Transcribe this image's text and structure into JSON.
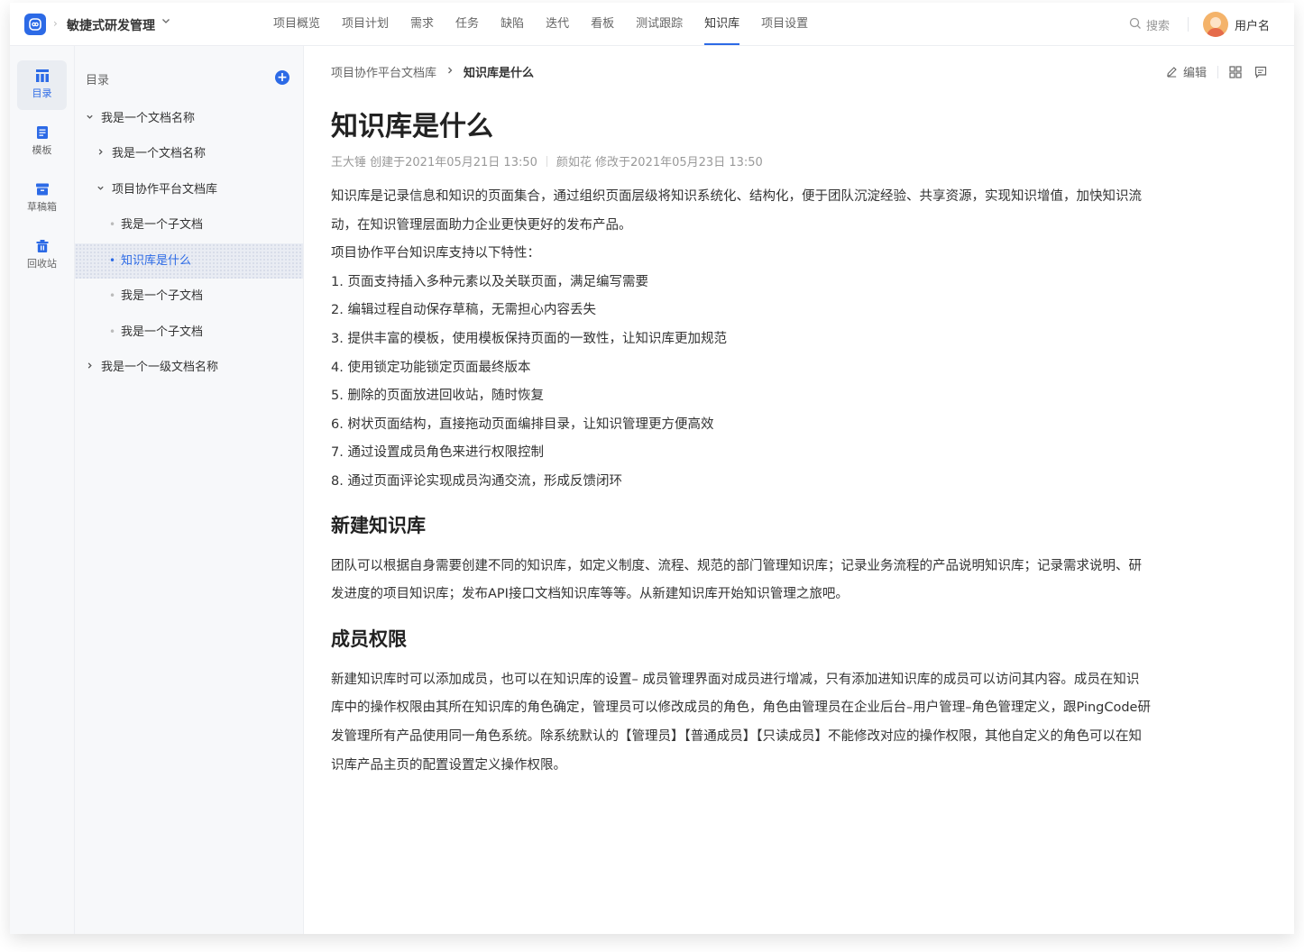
{
  "app": {
    "project_name": "敏捷式研发管理",
    "nav": [
      "项目概览",
      "项目计划",
      "需求",
      "任务",
      "缺陷",
      "迭代",
      "看板",
      "测试跟踪",
      "知识库",
      "项目设置"
    ],
    "active_nav": "知识库",
    "search_label": "搜索",
    "username": "用户名"
  },
  "rail": {
    "items": [
      {
        "label": "目录",
        "icon": "catalog-icon",
        "active": true
      },
      {
        "label": "模板",
        "icon": "template-icon",
        "active": false
      },
      {
        "label": "草稿箱",
        "icon": "draft-box-icon",
        "active": false
      },
      {
        "label": "回收站",
        "icon": "recycle-bin-icon",
        "active": false
      }
    ]
  },
  "toc": {
    "title": "目录",
    "add_label": "+",
    "items": [
      {
        "label": "我是一个文档名称",
        "level": 0,
        "type": "expanded"
      },
      {
        "label": "我是一个文档名称",
        "level": 1,
        "type": "collapsed"
      },
      {
        "label": "项目协作平台文档库",
        "level": 1,
        "type": "expanded"
      },
      {
        "label": "我是一个子文档",
        "level": 2,
        "type": "leaf"
      },
      {
        "label": "知识库是什么",
        "level": 2,
        "type": "leaf",
        "active": true
      },
      {
        "label": "我是一个子文档",
        "level": 2,
        "type": "leaf"
      },
      {
        "label": "我是一个子文档",
        "level": 2,
        "type": "leaf"
      },
      {
        "label": "我是一个一级文档名称",
        "level": 0,
        "type": "collapsed"
      }
    ]
  },
  "doc": {
    "breadcrumb_parent": "项目协作平台文档库",
    "breadcrumb_current": "知识库是什么",
    "edit_label": "编辑",
    "title": "知识库是什么",
    "created": "王大锤 创建于2021年05月21日 13:50",
    "modified": "颜如花 修改于2021年05月23日 13:50",
    "intro": "知识库是记录信息和知识的页面集合，通过组织页面层级将知识系统化、结构化，便于团队沉淀经验、共享资源，实现知识增值，加快知识流动，在知识管理层面助力企业更快更好的发布产品。",
    "features_title": "项目协作平台知识库支持以下特性：",
    "features": [
      "1. 页面支持插入多种元素以及关联页面，满足编写需要",
      "2. 编辑过程自动保存草稿，无需担心内容丢失",
      "3. 提供丰富的模板，使用模板保持页面的一致性，让知识库更加规范",
      "4. 使用锁定功能锁定页面最终版本",
      "5. 删除的页面放进回收站，随时恢复",
      "6. 树状页面结构，直接拖动页面编排目录，让知识管理更方便高效",
      "7. 通过设置成员角色来进行权限控制",
      "8. 通过页面评论实现成员沟通交流，形成反馈闭环"
    ],
    "section1_title": "新建知识库",
    "section1_text": "团队可以根据自身需要创建不同的知识库，如定义制度、流程、规范的部门管理知识库；记录业务流程的产品说明知识库；记录需求说明、研发进度的项目知识库；发布API接口文档知识库等等。从新建知识库开始知识管理之旅吧。",
    "section2_title": "成员权限",
    "section2_text": "新建知识库时可以添加成员，也可以在知识库的设置– 成员管理界面对成员进行增减，只有添加进知识库的成员可以访问其内容。成员在知识库中的操作权限由其所在知识库的角色确定，管理员可以修改成员的角色，角色由管理员在企业后台–用户管理–角色管理定义，跟PingCode研发管理所有产品使用同一角色系统。除系统默认的【管理员】【普通成员】【只读成员】不能修改对应的操作权限，其他自定义的角色可以在知识库产品主页的配置设置定义操作权限。"
  }
}
